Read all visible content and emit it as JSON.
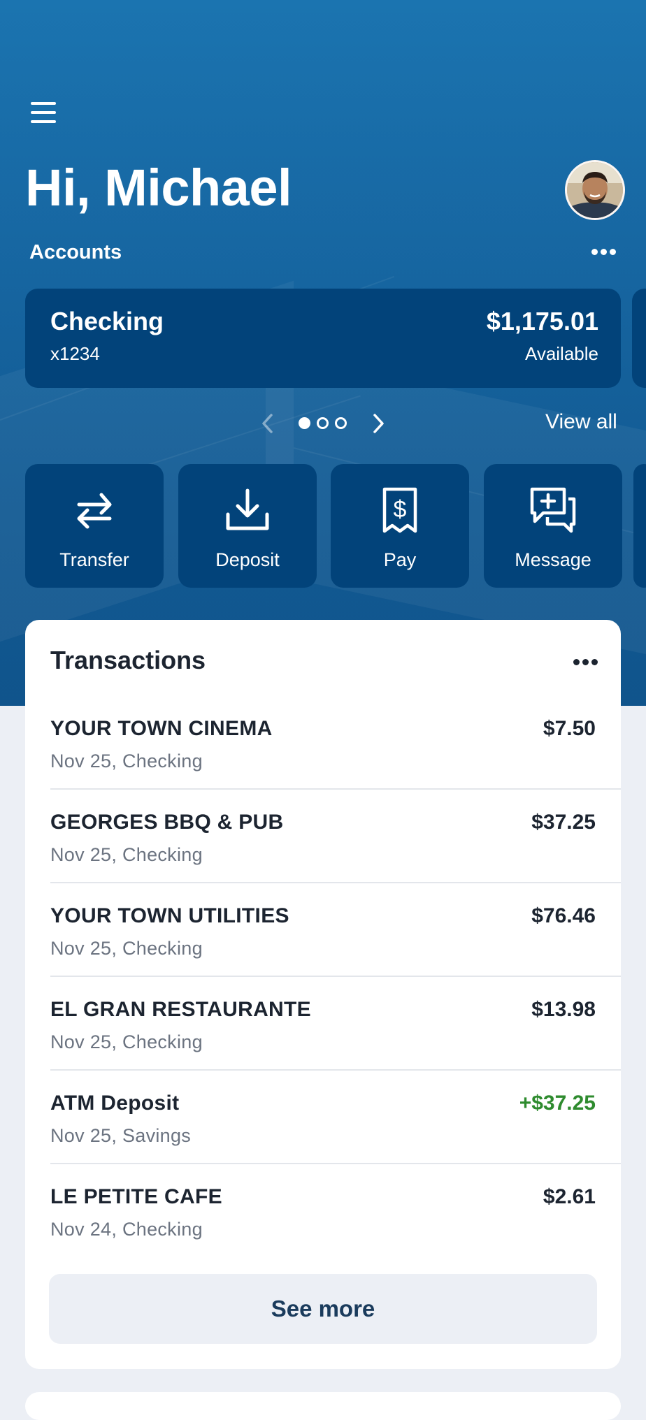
{
  "header": {
    "greeting": "Hi, Michael",
    "accounts_label": "Accounts",
    "view_all": "View all"
  },
  "account": {
    "name": "Checking",
    "number": "x1234",
    "balance": "$1,175.01",
    "balance_label": "Available"
  },
  "pager": {
    "current": 1,
    "total": 3
  },
  "actions": [
    {
      "label": "Transfer",
      "icon": "transfer-icon"
    },
    {
      "label": "Deposit",
      "icon": "deposit-icon"
    },
    {
      "label": "Pay",
      "icon": "pay-bill-icon"
    },
    {
      "label": "Message",
      "icon": "message-icon"
    }
  ],
  "transactions": {
    "title": "Transactions",
    "items": [
      {
        "name": "YOUR TOWN CINEMA",
        "detail": "Nov 25, Checking",
        "amount": "$7.50",
        "credit": false
      },
      {
        "name": "GEORGES BBQ & PUB",
        "detail": "Nov 25, Checking",
        "amount": "$37.25",
        "credit": false
      },
      {
        "name": "YOUR TOWN UTILITIES",
        "detail": "Nov 25, Checking",
        "amount": "$76.46",
        "credit": false
      },
      {
        "name": "EL GRAN RESTAURANTE",
        "detail": "Nov 25, Checking",
        "amount": "$13.98",
        "credit": false
      },
      {
        "name": "ATM Deposit",
        "detail": "Nov 25, Savings",
        "amount": "+$37.25",
        "credit": true
      },
      {
        "name": "LE PETITE CAFE",
        "detail": "Nov 24, Checking",
        "amount": "$2.61",
        "credit": false
      }
    ],
    "see_more": "See more"
  },
  "colors": {
    "hero": "#1b74b0",
    "card": "#02437a",
    "credit": "#2e8b2e",
    "text": "#1c2430",
    "muted": "#6b7380"
  }
}
